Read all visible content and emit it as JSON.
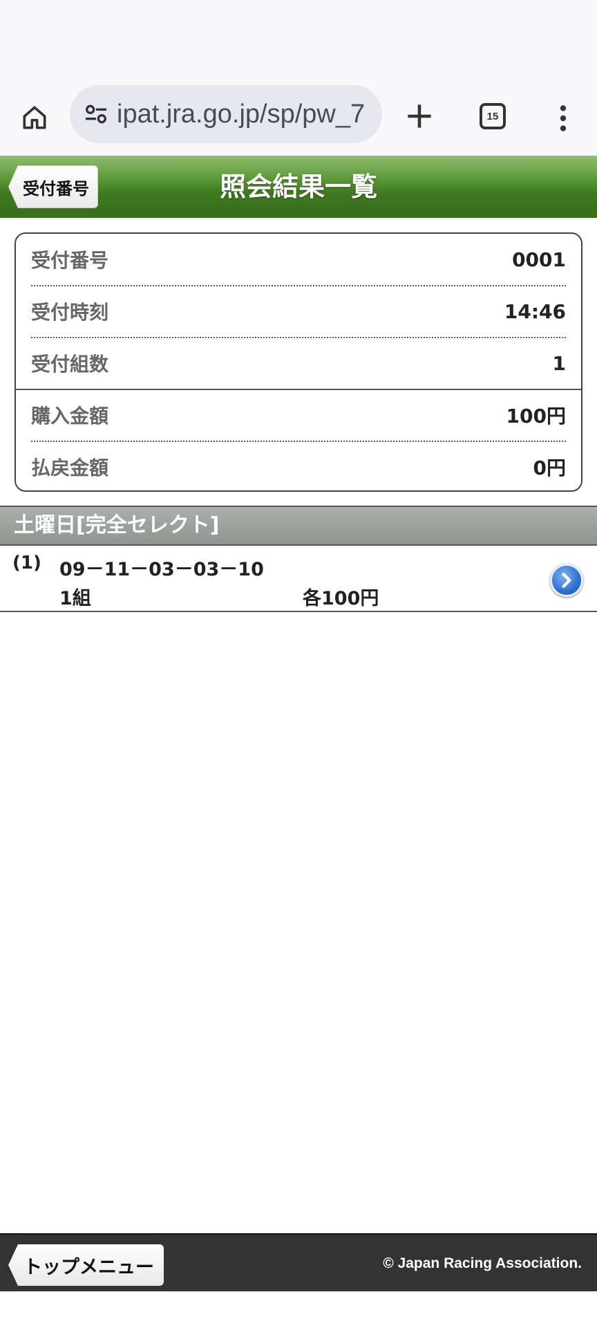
{
  "browser": {
    "url": "ipat.jra.go.jp/sp/pw_7",
    "tab_count": "15"
  },
  "header": {
    "back_label": "受付番号",
    "title": "照会結果一覧"
  },
  "summary": {
    "rows": [
      {
        "label": "受付番号",
        "value": "0001"
      },
      {
        "label": "受付時刻",
        "value": "14:46"
      },
      {
        "label": "受付組数",
        "value": "1"
      },
      {
        "label": "購入金額",
        "value": "100円"
      },
      {
        "label": "払戻金額",
        "value": "0円"
      }
    ]
  },
  "section": {
    "title": "土曜日[完全セレクト]"
  },
  "bets": [
    {
      "number": "(1)",
      "combination": "09－11－03－03－10",
      "sets": "1組",
      "amount": "各100円"
    }
  ],
  "footer": {
    "top_menu_label": "トップメニュー",
    "copyright": "© Japan Racing Association."
  },
  "colors": {
    "header_green": "#3f7a20",
    "section_gray": "#8e9590",
    "footer_dark": "#333333",
    "detail_blue": "#2e6fd0"
  }
}
